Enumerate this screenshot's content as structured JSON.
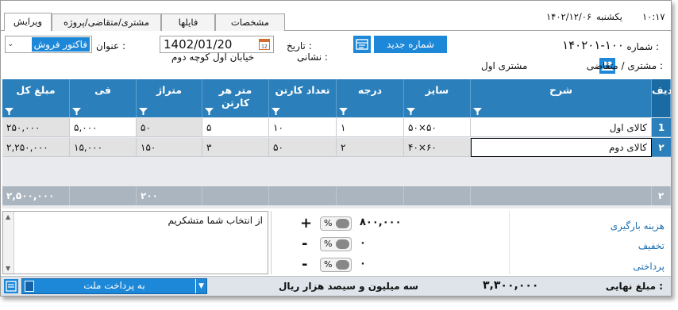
{
  "tabs": [
    {
      "label": "ویرایش"
    },
    {
      "label": "مشتری/متقاضی/پروژه"
    },
    {
      "label": "فایلها"
    },
    {
      "label": "مشخصات"
    }
  ],
  "status_top": {
    "time": "۱۰:۱۷",
    "weekday": "یکشنبه",
    "date": "۱۴۰۲/۱۲/۰۶"
  },
  "header": {
    "number_label": "شماره :",
    "number_value": "۱۴۰۲۰۱-۱۰۰",
    "new_number_button": "شماره جدید",
    "date_label": "تاریخ :",
    "date_value": "1402/01/20",
    "title_label": "عنوان :",
    "title_value": "فاکتور فروش",
    "customer_label": "مشتری / متقاضی :",
    "customer_value": "مشتری اول",
    "address_label": "نشانی :",
    "address_value": "خیابان اول کوچه دوم"
  },
  "grid": {
    "columns": [
      {
        "key": "row",
        "label": "ردیف"
      },
      {
        "key": "desc",
        "label": "شرح"
      },
      {
        "key": "size",
        "label": "سایز"
      },
      {
        "key": "grade",
        "label": "درجه"
      },
      {
        "key": "cartons",
        "label": "تعداد کارتن"
      },
      {
        "key": "m2_per_carton",
        "label": "متر هر کارتن"
      },
      {
        "key": "area",
        "label": "متراژ"
      },
      {
        "key": "unit_price",
        "label": "فی"
      },
      {
        "key": "total",
        "label": "مبلغ کل"
      }
    ],
    "rows": [
      {
        "row": "1",
        "desc": "کالای اول",
        "size": "۵۰×۵۰",
        "grade": "۱",
        "cartons": "۱۰",
        "m2_per_carton": "۵",
        "area": "۵۰",
        "unit_price": "۵,۰۰۰",
        "total": "۲۵۰,۰۰۰"
      },
      {
        "row": "۲",
        "desc": "کالای دوم",
        "size": "۴۰×۶۰",
        "grade": "۲",
        "cartons": "۵۰",
        "m2_per_carton": "۳",
        "area": "۱۵۰",
        "unit_price": "۱۵,۰۰۰",
        "total": "۲,۲۵۰,۰۰۰"
      }
    ],
    "totals": {
      "row": "۲",
      "area": "۲۰۰",
      "total": "۲,۵۰۰,۰۰۰"
    }
  },
  "footer": {
    "note_text": "از انتخاب شما متشکریم",
    "shipping_label": "هزینه بارگیری",
    "shipping_value": "۸۰۰,۰۰۰",
    "shipping_sign": "+",
    "discount_label": "تخفیف",
    "discount_value": "۰",
    "discount_sign": "-",
    "paid_label": "پرداختی",
    "paid_value": "۰",
    "paid_sign": "-",
    "percent_symbol": "%"
  },
  "status_bar": {
    "final_amount_label": "مبلغ نهایی :",
    "final_amount_value": "۳,۳۰۰,۰۰۰",
    "amount_in_words": "سه میلیون و سیصد  هزار  ریال",
    "payment_method": "به پرداخت ملت"
  },
  "colors": {
    "header_blue": "#2b7fba",
    "accent_blue": "#1e88d8",
    "link_blue": "#1e6fb0"
  }
}
